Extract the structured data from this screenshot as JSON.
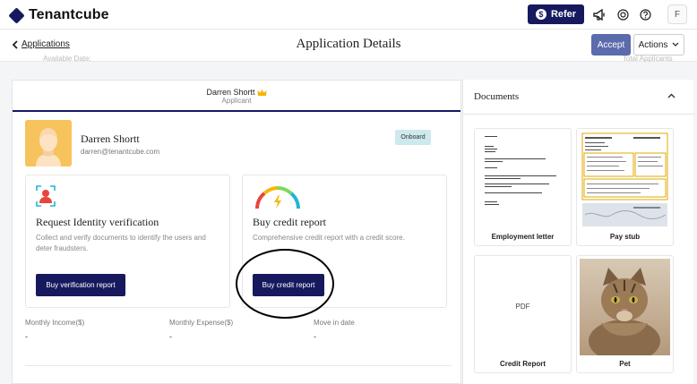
{
  "topbar": {
    "logo_text": "Tenantcube",
    "refer_label": "Refer",
    "refer_coin": "$",
    "icons": [
      "megaphone-icon",
      "help-ring-icon",
      "question-icon"
    ],
    "user_initial": "F"
  },
  "subheader": {
    "back_label": "Applications",
    "title": "Application Details",
    "accept_label": "Accept",
    "actions_label": "Actions"
  },
  "faded": {
    "left": "Available Date:",
    "right": "Total Applicants"
  },
  "applicant": {
    "tab_name": "Darren Shortt",
    "tab_role": "Applicant",
    "name": "Darren Shortt",
    "email": "darren@tenantcube.com",
    "status": "Onboard"
  },
  "services": [
    {
      "title": "Request Identity verification",
      "description": "Collect and verify documents to identify the users and deter fraudsters.",
      "button": "Buy verification report"
    },
    {
      "title": "Buy credit report",
      "description": "Comprehensive credit report with a credit score.",
      "button": "Buy credit report"
    }
  ],
  "stats": [
    {
      "label": "Monthly Income($)",
      "value": "-"
    },
    {
      "label": "Monthly Expense($)",
      "value": "-"
    },
    {
      "label": "Move in date",
      "value": "-"
    }
  ],
  "documents": {
    "title": "Documents",
    "items": [
      {
        "label": "Employment letter"
      },
      {
        "label": "Pay stub"
      },
      {
        "label": "Credit Report",
        "preview_text": "PDF"
      },
      {
        "label": "Pet"
      }
    ]
  },
  "colors": {
    "navy": "#16195e",
    "accept": "#5b6bab",
    "badge": "#cde9ee"
  }
}
